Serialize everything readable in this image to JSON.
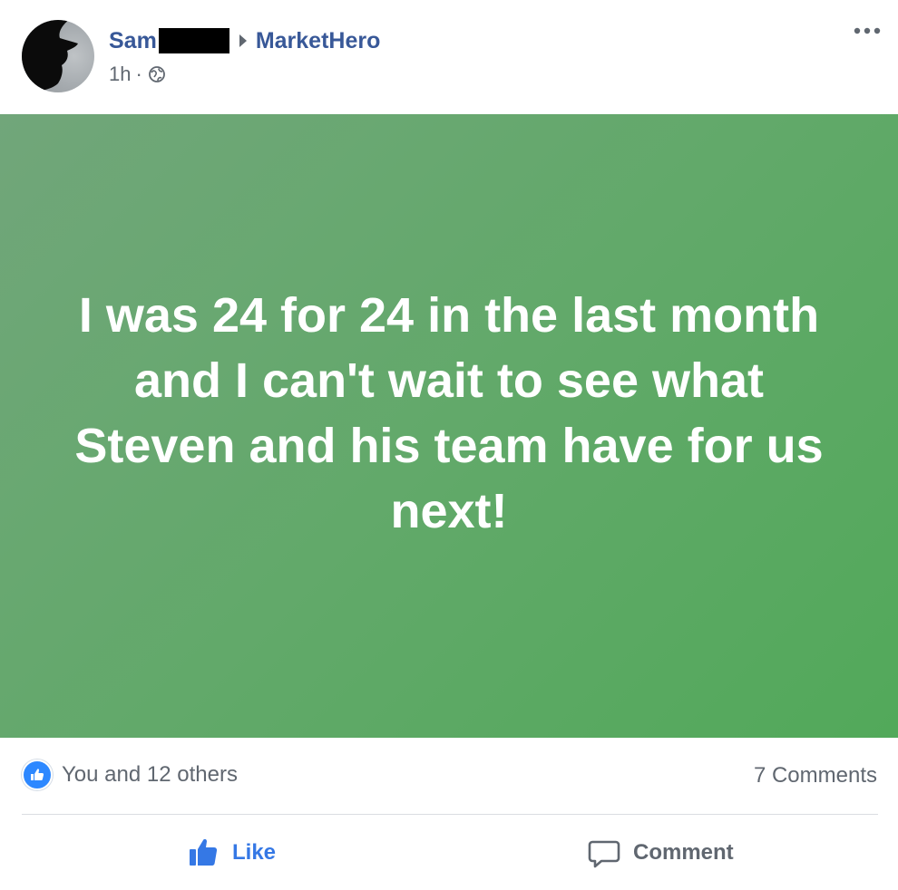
{
  "post": {
    "author": "Sam",
    "group": "MarketHero",
    "time": "1h",
    "separator": "·",
    "content": "I was 24 for 24 in the last month and I can't wait to see what Steven and his team have for us next!",
    "background_colors": [
      "#71a67a",
      "#52a95a"
    ]
  },
  "stats": {
    "reactions": "You and 12 others",
    "comments": "7 Comments"
  },
  "actions": {
    "like": "Like",
    "comment": "Comment"
  },
  "icons": {
    "more": "more-options-icon",
    "audience": "globe-icon",
    "like": "thumbs-up-icon",
    "comment": "comment-bubble-icon"
  },
  "colors": {
    "link": "#385898",
    "like_active": "#3578e5",
    "muted": "#606770"
  }
}
